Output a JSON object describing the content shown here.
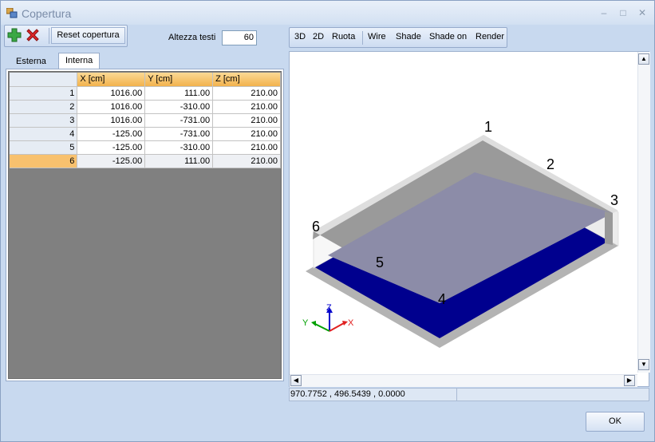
{
  "window": {
    "title": "Copertura"
  },
  "toolbar": {
    "reset_label": "Reset copertura",
    "altezza_label": "Altezza testi",
    "altezza_value": "60"
  },
  "tabs": [
    {
      "label": "Esterna"
    },
    {
      "label": "Interna"
    }
  ],
  "grid": {
    "headers": [
      "X [cm]",
      "Y [cm]",
      "Z [cm]"
    ],
    "rows": [
      {
        "n": "1",
        "x": "1016.00",
        "y": "111.00",
        "z": "210.00"
      },
      {
        "n": "2",
        "x": "1016.00",
        "y": "-310.00",
        "z": "210.00"
      },
      {
        "n": "3",
        "x": "1016.00",
        "y": "-731.00",
        "z": "210.00"
      },
      {
        "n": "4",
        "x": "-125.00",
        "y": "-731.00",
        "z": "210.00"
      },
      {
        "n": "5",
        "x": "-125.00",
        "y": "-310.00",
        "z": "210.00"
      },
      {
        "n": "6",
        "x": "-125.00",
        "y": "111.00",
        "z": "210.00"
      }
    ],
    "selected_row": "6"
  },
  "view_toolbar": {
    "b3d": "3D",
    "b2d": "2D",
    "ruota": "Ruota",
    "wire": "Wire",
    "shade": "Shade",
    "shade_on": "Shade on",
    "render": "Render"
  },
  "viewport": {
    "labels": [
      "1",
      "2",
      "3",
      "4",
      "5",
      "6"
    ],
    "axes": {
      "x": "X",
      "y": "Y",
      "z": "Z"
    },
    "colors": {
      "slab": "#00008e",
      "roof": "#9a9a9a"
    }
  },
  "status": {
    "coords": "970.7752 , 496.5439 , 0.0000"
  },
  "ok_label": "OK"
}
